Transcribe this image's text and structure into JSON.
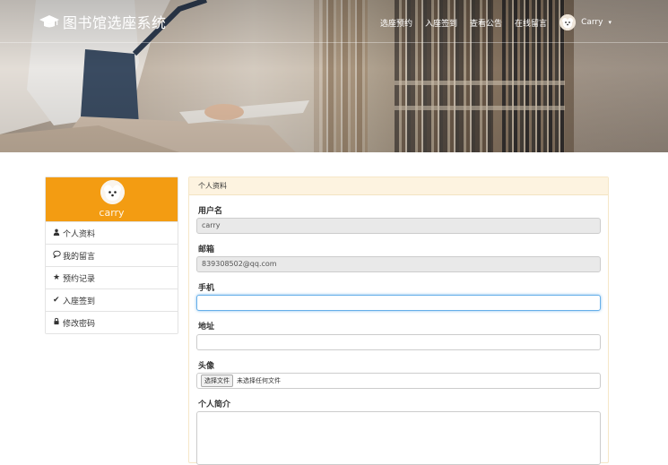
{
  "brand": {
    "title": "图书馆选座系统",
    "icon": "graduation-cap-icon"
  },
  "nav": {
    "items": [
      "选座预约",
      "入座签到",
      "查看公告",
      "在线留言"
    ],
    "user_name": "Carry",
    "user_caret": "▾"
  },
  "sidebar": {
    "username": "carry",
    "accent": "#f39c12",
    "items": [
      {
        "label": "个人资料",
        "icon": "user-icon",
        "glyph": "👤"
      },
      {
        "label": "我的留言",
        "icon": "comment-icon",
        "glyph": "💬"
      },
      {
        "label": "预约记录",
        "icon": "star-icon",
        "glyph": "★"
      },
      {
        "label": "入座签到",
        "icon": "check-icon",
        "glyph": "✔"
      },
      {
        "label": "修改密码",
        "icon": "lock-icon",
        "glyph": "🔒"
      }
    ]
  },
  "panel": {
    "title": "个人资料",
    "fields": {
      "username_label": "用户名",
      "username_value": "carry",
      "email_label": "邮箱",
      "email_value": "839308502@qq.com",
      "phone_label": "手机",
      "phone_value": "",
      "address_label": "地址",
      "address_value": "",
      "avatar_label": "头像",
      "file_button": "选择文件",
      "file_status": "未选择任何文件",
      "bio_label": "个人简介",
      "bio_value": ""
    }
  }
}
